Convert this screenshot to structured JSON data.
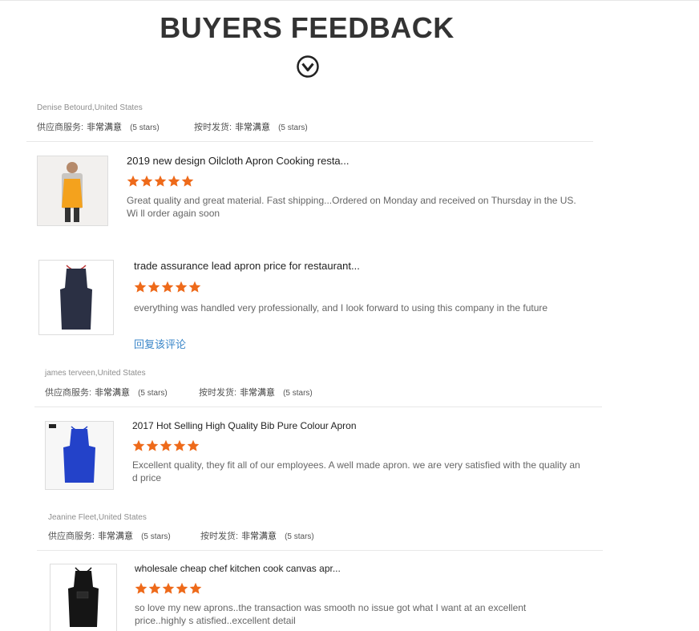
{
  "header": {
    "title": "BUYERS FEEDBACK",
    "scroll_icon": "circle-chevron-down-icon"
  },
  "colors": {
    "star": "#ee6a1a",
    "link": "#3a86c8"
  },
  "labels": {
    "supplier_service": "供应商服务:",
    "on_time_delivery": "按时发货:",
    "very_satisfied": "非常满意",
    "five_stars": "(5 stars)"
  },
  "reviews": [
    {
      "buyer": "Denise Betourd,United States",
      "product": "2019 new design Oilcloth Apron Cooking resta...",
      "rating": 5,
      "text": "Great quality and great material. Fast shipping...Ordered on Monday and received on Thursday in the US. Wi ll order again soon",
      "apron_color": "#f4a21d"
    },
    {
      "product": "trade assurance lead apron price for restaurant...",
      "rating": 5,
      "text": "everything was handled very professionally, and I look forward to using this company in the future",
      "reply_link": "回复该评论",
      "apron_color": "#2b3044"
    },
    {
      "buyer": "james terveen,United States",
      "product": "2017 Hot Selling High Quality Bib Pure Colour Apron",
      "rating": 5,
      "text": "Excellent quality,  they fit all of our employees. A well made apron.  we are very satisfied with the quality an d price",
      "apron_color": "#2342c9"
    },
    {
      "buyer": "Jeanine Fleet,United States",
      "product": "wholesale cheap chef kitchen cook canvas apr...",
      "rating": 5,
      "text": "so love my new aprons..the transaction was smooth no issue got what I want at an excellent price..highly s atisfied..excellent detail",
      "apron_color": "#151515"
    }
  ]
}
